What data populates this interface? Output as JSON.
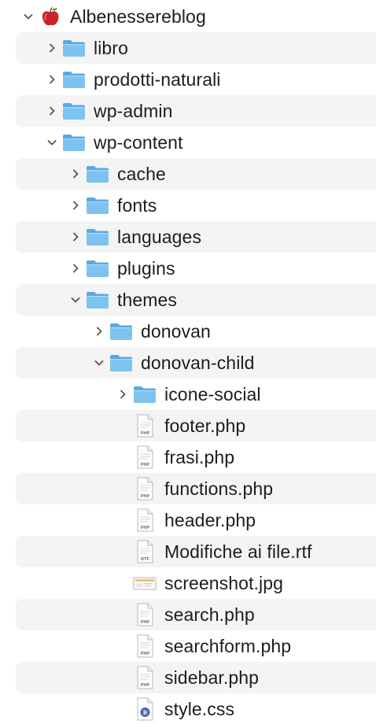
{
  "window": {
    "title": "Albenessereblog"
  },
  "items": [
    {
      "label": "Albenessereblog",
      "depth": 0,
      "kind": "app",
      "expanded": true
    },
    {
      "label": "libro",
      "depth": 1,
      "kind": "folder",
      "expanded": false
    },
    {
      "label": "prodotti-naturali",
      "depth": 1,
      "kind": "folder",
      "expanded": false
    },
    {
      "label": "wp-admin",
      "depth": 1,
      "kind": "folder",
      "expanded": false
    },
    {
      "label": "wp-content",
      "depth": 1,
      "kind": "folder",
      "expanded": true
    },
    {
      "label": "cache",
      "depth": 2,
      "kind": "folder",
      "expanded": false
    },
    {
      "label": "fonts",
      "depth": 2,
      "kind": "folder",
      "expanded": false
    },
    {
      "label": "languages",
      "depth": 2,
      "kind": "folder",
      "expanded": false
    },
    {
      "label": "plugins",
      "depth": 2,
      "kind": "folder",
      "expanded": false
    },
    {
      "label": "themes",
      "depth": 2,
      "kind": "folder",
      "expanded": true
    },
    {
      "label": "donovan",
      "depth": 3,
      "kind": "folder",
      "expanded": false
    },
    {
      "label": "donovan-child",
      "depth": 3,
      "kind": "folder",
      "expanded": true
    },
    {
      "label": "icone-social",
      "depth": 4,
      "kind": "folder",
      "expanded": false
    },
    {
      "label": "footer.php",
      "depth": 4,
      "kind": "file",
      "badge": "PHP"
    },
    {
      "label": "frasi.php",
      "depth": 4,
      "kind": "file",
      "badge": "PHP"
    },
    {
      "label": "functions.php",
      "depth": 4,
      "kind": "file",
      "badge": "PHP"
    },
    {
      "label": "header.php",
      "depth": 4,
      "kind": "file",
      "badge": "PHP"
    },
    {
      "label": "Modifiche ai file.rtf",
      "depth": 4,
      "kind": "file",
      "badge": "RTF"
    },
    {
      "label": "screenshot.jpg",
      "depth": 4,
      "kind": "image"
    },
    {
      "label": "search.php",
      "depth": 4,
      "kind": "file",
      "badge": "PHP"
    },
    {
      "label": "searchform.php",
      "depth": 4,
      "kind": "file",
      "badge": "PHP"
    },
    {
      "label": "sidebar.php",
      "depth": 4,
      "kind": "file",
      "badge": "PHP"
    },
    {
      "label": "style.css",
      "depth": 4,
      "kind": "css"
    }
  ],
  "colors": {
    "stripe": "#f4f4f4",
    "folder_front": "#7dc3f0",
    "folder_back": "#5aa9e0",
    "chevron": "#555555",
    "text": "#1d1d1d"
  }
}
